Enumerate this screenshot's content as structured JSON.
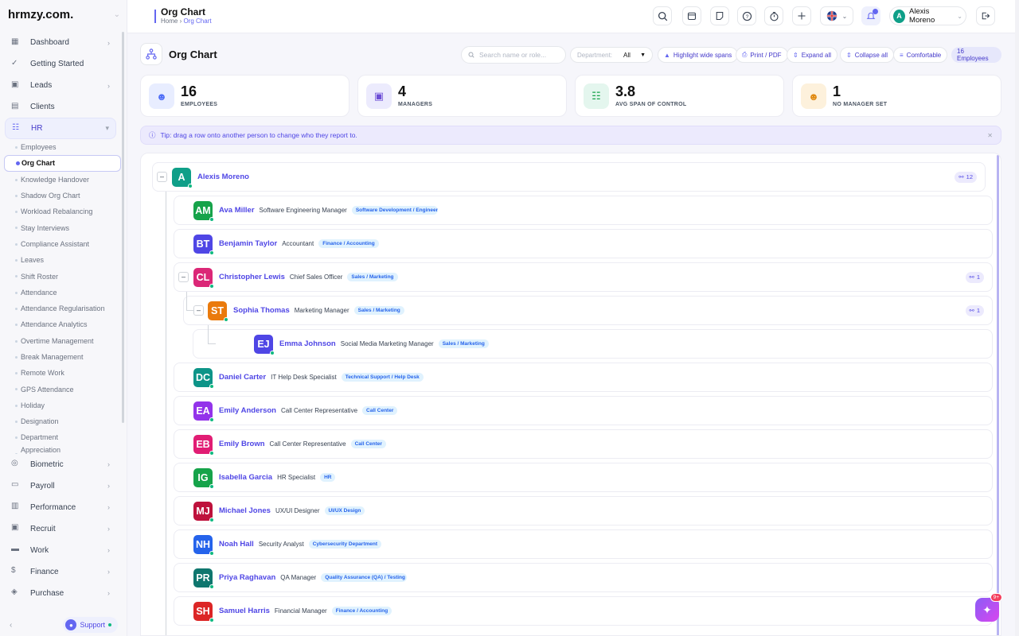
{
  "brand": {
    "logo": "hrmzy.com."
  },
  "sidebar": {
    "items_top": [
      {
        "label": "Dashboard",
        "icon": "dashboard-icon",
        "arrow": true
      },
      {
        "label": "Getting Started",
        "icon": "check-circle-icon",
        "arrow": false
      },
      {
        "label": "Leads",
        "icon": "leads-icon",
        "arrow": true
      },
      {
        "label": "Clients",
        "icon": "clients-icon",
        "arrow": false
      },
      {
        "label": "HR",
        "icon": "users-icon",
        "arrow": true,
        "open": true
      }
    ],
    "hr_sub": [
      "Employees",
      "Org Chart",
      "Knowledge Handover",
      "Shadow Org Chart",
      "Workload Rebalancing",
      "Stay Interviews",
      "Compliance Assistant",
      "Leaves",
      "Shift Roster",
      "Attendance",
      "Attendance Regularisation",
      "Attendance Analytics",
      "Overtime Management",
      "Break Management",
      "Remote Work",
      "GPS Attendance",
      "Holiday",
      "Designation",
      "Department",
      "Appreciation"
    ],
    "active_sub": "Org Chart",
    "items_bottom": [
      {
        "label": "Biometric",
        "icon": "fingerprint-icon"
      },
      {
        "label": "Payroll",
        "icon": "payroll-icon"
      },
      {
        "label": "Performance",
        "icon": "performance-icon"
      },
      {
        "label": "Recruit",
        "icon": "recruit-icon"
      },
      {
        "label": "Work",
        "icon": "briefcase-icon"
      },
      {
        "label": "Finance",
        "icon": "dollar-icon"
      },
      {
        "label": "Purchase",
        "icon": "purchase-icon"
      }
    ],
    "support_label": "Support"
  },
  "header": {
    "title": "Org Chart",
    "crumb_home": "Home",
    "crumb_current": "Org Chart",
    "user_initial": "A",
    "user_name": "Alexis Moreno"
  },
  "toolbar": {
    "page_title": "Org Chart",
    "search_placeholder": "Search name or role...",
    "department_label": "Department:",
    "department_value": "All",
    "highlight_label": "Highlight wide spans",
    "print_label": "Print / PDF",
    "expand_label": "Expand all",
    "collapse_label": "Collapse all",
    "density_label": "Comfortable",
    "count_label": "16 Employees"
  },
  "stats": [
    {
      "value": "16",
      "label": "EMPLOYEES",
      "icon": "users-icon",
      "bg": "#e8edff",
      "fg": "#4f6ef7"
    },
    {
      "value": "4",
      "label": "MANAGERS",
      "icon": "briefcase-icon",
      "bg": "#ecebfd",
      "fg": "#6d4fd6"
    },
    {
      "value": "3.8",
      "label": "AVG SPAN OF CONTROL",
      "icon": "sitemap-icon",
      "bg": "#e4f6ee",
      "fg": "#16a34a"
    },
    {
      "value": "1",
      "label": "NO MANAGER SET",
      "icon": "user-x-icon",
      "bg": "#fdf1dc",
      "fg": "#e08a12"
    }
  ],
  "tip": "Tip: drag a row onto another person to change who they report to.",
  "tree": [
    {
      "initials": "A",
      "name": "Alexis Moreno",
      "role": "",
      "dept": "",
      "color": "#0f9f88",
      "level": 0,
      "toggle": true,
      "count": "12"
    },
    {
      "initials": "AM",
      "name": "Ava Miller",
      "role": "Software Engineering Manager",
      "dept": "Software Development / Engineering",
      "color": "#16a34a",
      "level": 1,
      "toggle": false,
      "count": ""
    },
    {
      "initials": "BT",
      "name": "Benjamin Taylor",
      "role": "Accountant",
      "dept": "Finance / Accounting",
      "color": "#4f46e5",
      "level": 1,
      "toggle": false,
      "count": ""
    },
    {
      "initials": "CL",
      "name": "Christopher Lewis",
      "role": "Chief Sales Officer",
      "dept": "Sales / Marketing",
      "color": "#db2777",
      "level": 1,
      "toggle": true,
      "count": "1"
    },
    {
      "initials": "ST",
      "name": "Sophia Thomas",
      "role": "Marketing Manager",
      "dept": "Sales / Marketing",
      "color": "#ea7a0c",
      "level": 2,
      "toggle": true,
      "count": "1"
    },
    {
      "initials": "EJ",
      "name": "Emma Johnson",
      "role": "Social Media Marketing Manager",
      "dept": "Sales / Marketing",
      "color": "#4f46e5",
      "level": 3,
      "toggle": false,
      "count": ""
    },
    {
      "initials": "DC",
      "name": "Daniel Carter",
      "role": "IT Help Desk Specialist",
      "dept": "Technical Support / Help Desk",
      "color": "#0d9488",
      "level": 1,
      "toggle": false,
      "count": ""
    },
    {
      "initials": "EA",
      "name": "Emily Anderson",
      "role": "Call Center Representative",
      "dept": "Call Center",
      "color": "#9333ea",
      "level": 1,
      "toggle": false,
      "count": ""
    },
    {
      "initials": "EB",
      "name": "Emily Brown",
      "role": "Call Center Representative",
      "dept": "Call Center",
      "color": "#e11d74",
      "level": 1,
      "toggle": false,
      "count": ""
    },
    {
      "initials": "IG",
      "name": "Isabella Garcia",
      "role": "HR Specialist",
      "dept": "HR",
      "color": "#16a34a",
      "level": 1,
      "toggle": false,
      "count": ""
    },
    {
      "initials": "MJ",
      "name": "Michael Jones",
      "role": "UX/UI Designer",
      "dept": "UI/UX Design",
      "color": "#be123c",
      "level": 1,
      "toggle": false,
      "count": ""
    },
    {
      "initials": "NH",
      "name": "Noah Hall",
      "role": "Security Analyst",
      "dept": "Cybersecurity Department",
      "color": "#2563eb",
      "level": 1,
      "toggle": false,
      "count": ""
    },
    {
      "initials": "PR",
      "name": "Priya Raghavan",
      "role": "QA Manager",
      "dept": "Quality Assurance (QA) / Testing",
      "color": "#0f766e",
      "level": 1,
      "toggle": false,
      "count": ""
    },
    {
      "initials": "SH",
      "name": "Samuel Harris",
      "role": "Financial Manager",
      "dept": "Finance / Accounting",
      "color": "#dc2626",
      "level": 1,
      "toggle": false,
      "count": ""
    }
  ],
  "fab_badge": "9+"
}
